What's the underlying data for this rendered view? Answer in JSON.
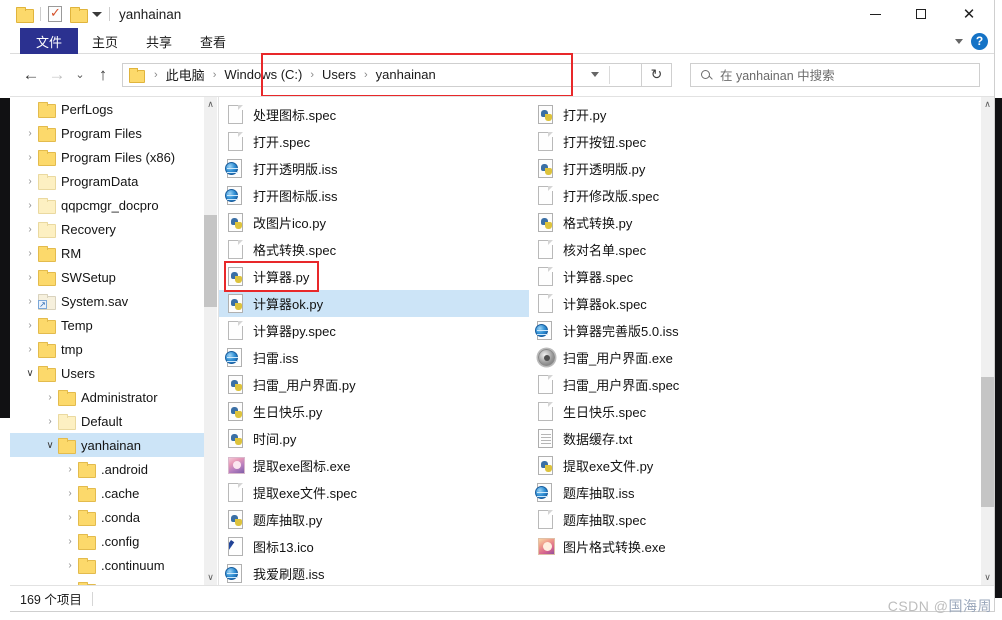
{
  "window": {
    "title": "yanhainan",
    "minimize_label": "—",
    "maximize_label": "□",
    "close_label": "✕"
  },
  "quick_access": {
    "folder_icon": "folder-icon",
    "properties_icon": "properties-icon",
    "new_folder_icon": "new-folder-icon",
    "customize_label": "▾"
  },
  "ribbon": {
    "tabs": [
      {
        "label": "文件",
        "active": true
      },
      {
        "label": "主页",
        "active": false
      },
      {
        "label": "共享",
        "active": false
      },
      {
        "label": "查看",
        "active": false
      }
    ],
    "collapse_icon": "chevron-down-icon",
    "help_label": "?"
  },
  "address": {
    "back_label": "←",
    "forward_label": "→",
    "recent_label": "⌄",
    "up_label": "↑",
    "folder_icon": "folder-icon",
    "crumbs": [
      "此电脑",
      "Windows (C:)",
      "Users",
      "yanhainan"
    ],
    "separator": "›",
    "dropdown_label": "⌄",
    "refresh_label": "↻",
    "highlight_color": "#e8282a"
  },
  "search": {
    "icon": "search-icon",
    "placeholder": "在 yanhainan 中搜索",
    "value": ""
  },
  "tree": {
    "scroll_up_label": "∧",
    "scroll_down_label": "∨",
    "items": [
      {
        "label": "PerfLogs",
        "indent": 1,
        "chevron": "",
        "style": "normal"
      },
      {
        "label": "Program Files",
        "indent": 1,
        "chevron": "›",
        "style": "normal"
      },
      {
        "label": "Program Files (x86)",
        "indent": 1,
        "chevron": "›",
        "style": "normal"
      },
      {
        "label": "ProgramData",
        "indent": 1,
        "chevron": "›",
        "style": "pale"
      },
      {
        "label": "qqpcmgr_docpro",
        "indent": 1,
        "chevron": "›",
        "style": "pale"
      },
      {
        "label": "Recovery",
        "indent": 1,
        "chevron": "›",
        "style": "pale"
      },
      {
        "label": "RM",
        "indent": 1,
        "chevron": "›",
        "style": "normal"
      },
      {
        "label": "SWSetup",
        "indent": 1,
        "chevron": "›",
        "style": "normal"
      },
      {
        "label": "System.sav",
        "indent": 1,
        "chevron": "›",
        "style": "shortcut"
      },
      {
        "label": "Temp",
        "indent": 1,
        "chevron": "›",
        "style": "normal"
      },
      {
        "label": "tmp",
        "indent": 1,
        "chevron": "›",
        "style": "normal"
      },
      {
        "label": "Users",
        "indent": 1,
        "chevron": "∨",
        "style": "normal"
      },
      {
        "label": "Administrator",
        "indent": 2,
        "chevron": "›",
        "style": "normal"
      },
      {
        "label": "Default",
        "indent": 2,
        "chevron": "›",
        "style": "pale"
      },
      {
        "label": "yanhainan",
        "indent": 2,
        "chevron": "∨",
        "style": "normal",
        "selected": true
      },
      {
        "label": ".android",
        "indent": 3,
        "chevron": "›",
        "style": "normal"
      },
      {
        "label": ".cache",
        "indent": 3,
        "chevron": "›",
        "style": "normal"
      },
      {
        "label": ".conda",
        "indent": 3,
        "chevron": "›",
        "style": "normal"
      },
      {
        "label": ".config",
        "indent": 3,
        "chevron": "›",
        "style": "normal"
      },
      {
        "label": ".continuum",
        "indent": 3,
        "chevron": "›",
        "style": "normal"
      },
      {
        "label": "",
        "indent": 3,
        "chevron": "›",
        "style": "normal"
      }
    ]
  },
  "files": {
    "scroll_up_label": "∧",
    "scroll_down_label": "∨",
    "highlight_color": "#e8282a",
    "column1": [
      {
        "name": "处理图标.spec",
        "icon": "doc"
      },
      {
        "name": "打开.spec",
        "icon": "doc"
      },
      {
        "name": "打开透明版.iss",
        "icon": "iss"
      },
      {
        "name": "打开图标版.iss",
        "icon": "iss"
      },
      {
        "name": "改图片ico.py",
        "icon": "py"
      },
      {
        "name": "格式转换.spec",
        "icon": "doc"
      },
      {
        "name": "计算器.py",
        "icon": "py",
        "outlined": true
      },
      {
        "name": "计算器ok.py",
        "icon": "py",
        "selected": true
      },
      {
        "name": "计算器py.spec",
        "icon": "doc"
      },
      {
        "name": "扫雷.iss",
        "icon": "iss"
      },
      {
        "name": "扫雷_用户界面.py",
        "icon": "py"
      },
      {
        "name": "生日快乐.py",
        "icon": "py"
      },
      {
        "name": "时间.py",
        "icon": "py"
      },
      {
        "name": "提取exe图标.exe",
        "icon": "img1"
      },
      {
        "name": "提取exe文件.spec",
        "icon": "doc"
      },
      {
        "name": "题库抽取.py",
        "icon": "py"
      },
      {
        "name": "图标13.ico",
        "icon": "ico"
      },
      {
        "name": "我爱刷题.iss",
        "icon": "iss"
      }
    ],
    "column2": [
      {
        "name": "打开.py",
        "icon": "py"
      },
      {
        "name": "打开按钮.spec",
        "icon": "doc"
      },
      {
        "name": "打开透明版.py",
        "icon": "py"
      },
      {
        "name": "打开修改版.spec",
        "icon": "doc"
      },
      {
        "name": "格式转换.py",
        "icon": "py"
      },
      {
        "name": "核对名单.spec",
        "icon": "doc"
      },
      {
        "name": "计算器.spec",
        "icon": "doc"
      },
      {
        "name": "计算器ok.spec",
        "icon": "doc"
      },
      {
        "name": "计算器完善版5.0.iss",
        "icon": "iss"
      },
      {
        "name": "扫雷_用户界面.exe",
        "icon": "gear"
      },
      {
        "name": "扫雷_用户界面.spec",
        "icon": "doc"
      },
      {
        "name": "生日快乐.spec",
        "icon": "doc"
      },
      {
        "name": "数据缓存.txt",
        "icon": "txt"
      },
      {
        "name": "提取exe文件.py",
        "icon": "py"
      },
      {
        "name": "题库抽取.iss",
        "icon": "iss"
      },
      {
        "name": "题库抽取.spec",
        "icon": "doc"
      },
      {
        "name": "图片格式转换.exe",
        "icon": "img2"
      }
    ]
  },
  "status": {
    "item_count": "169 个项目"
  },
  "watermark": {
    "prefix": "CSDN @",
    "name": "国海周"
  }
}
